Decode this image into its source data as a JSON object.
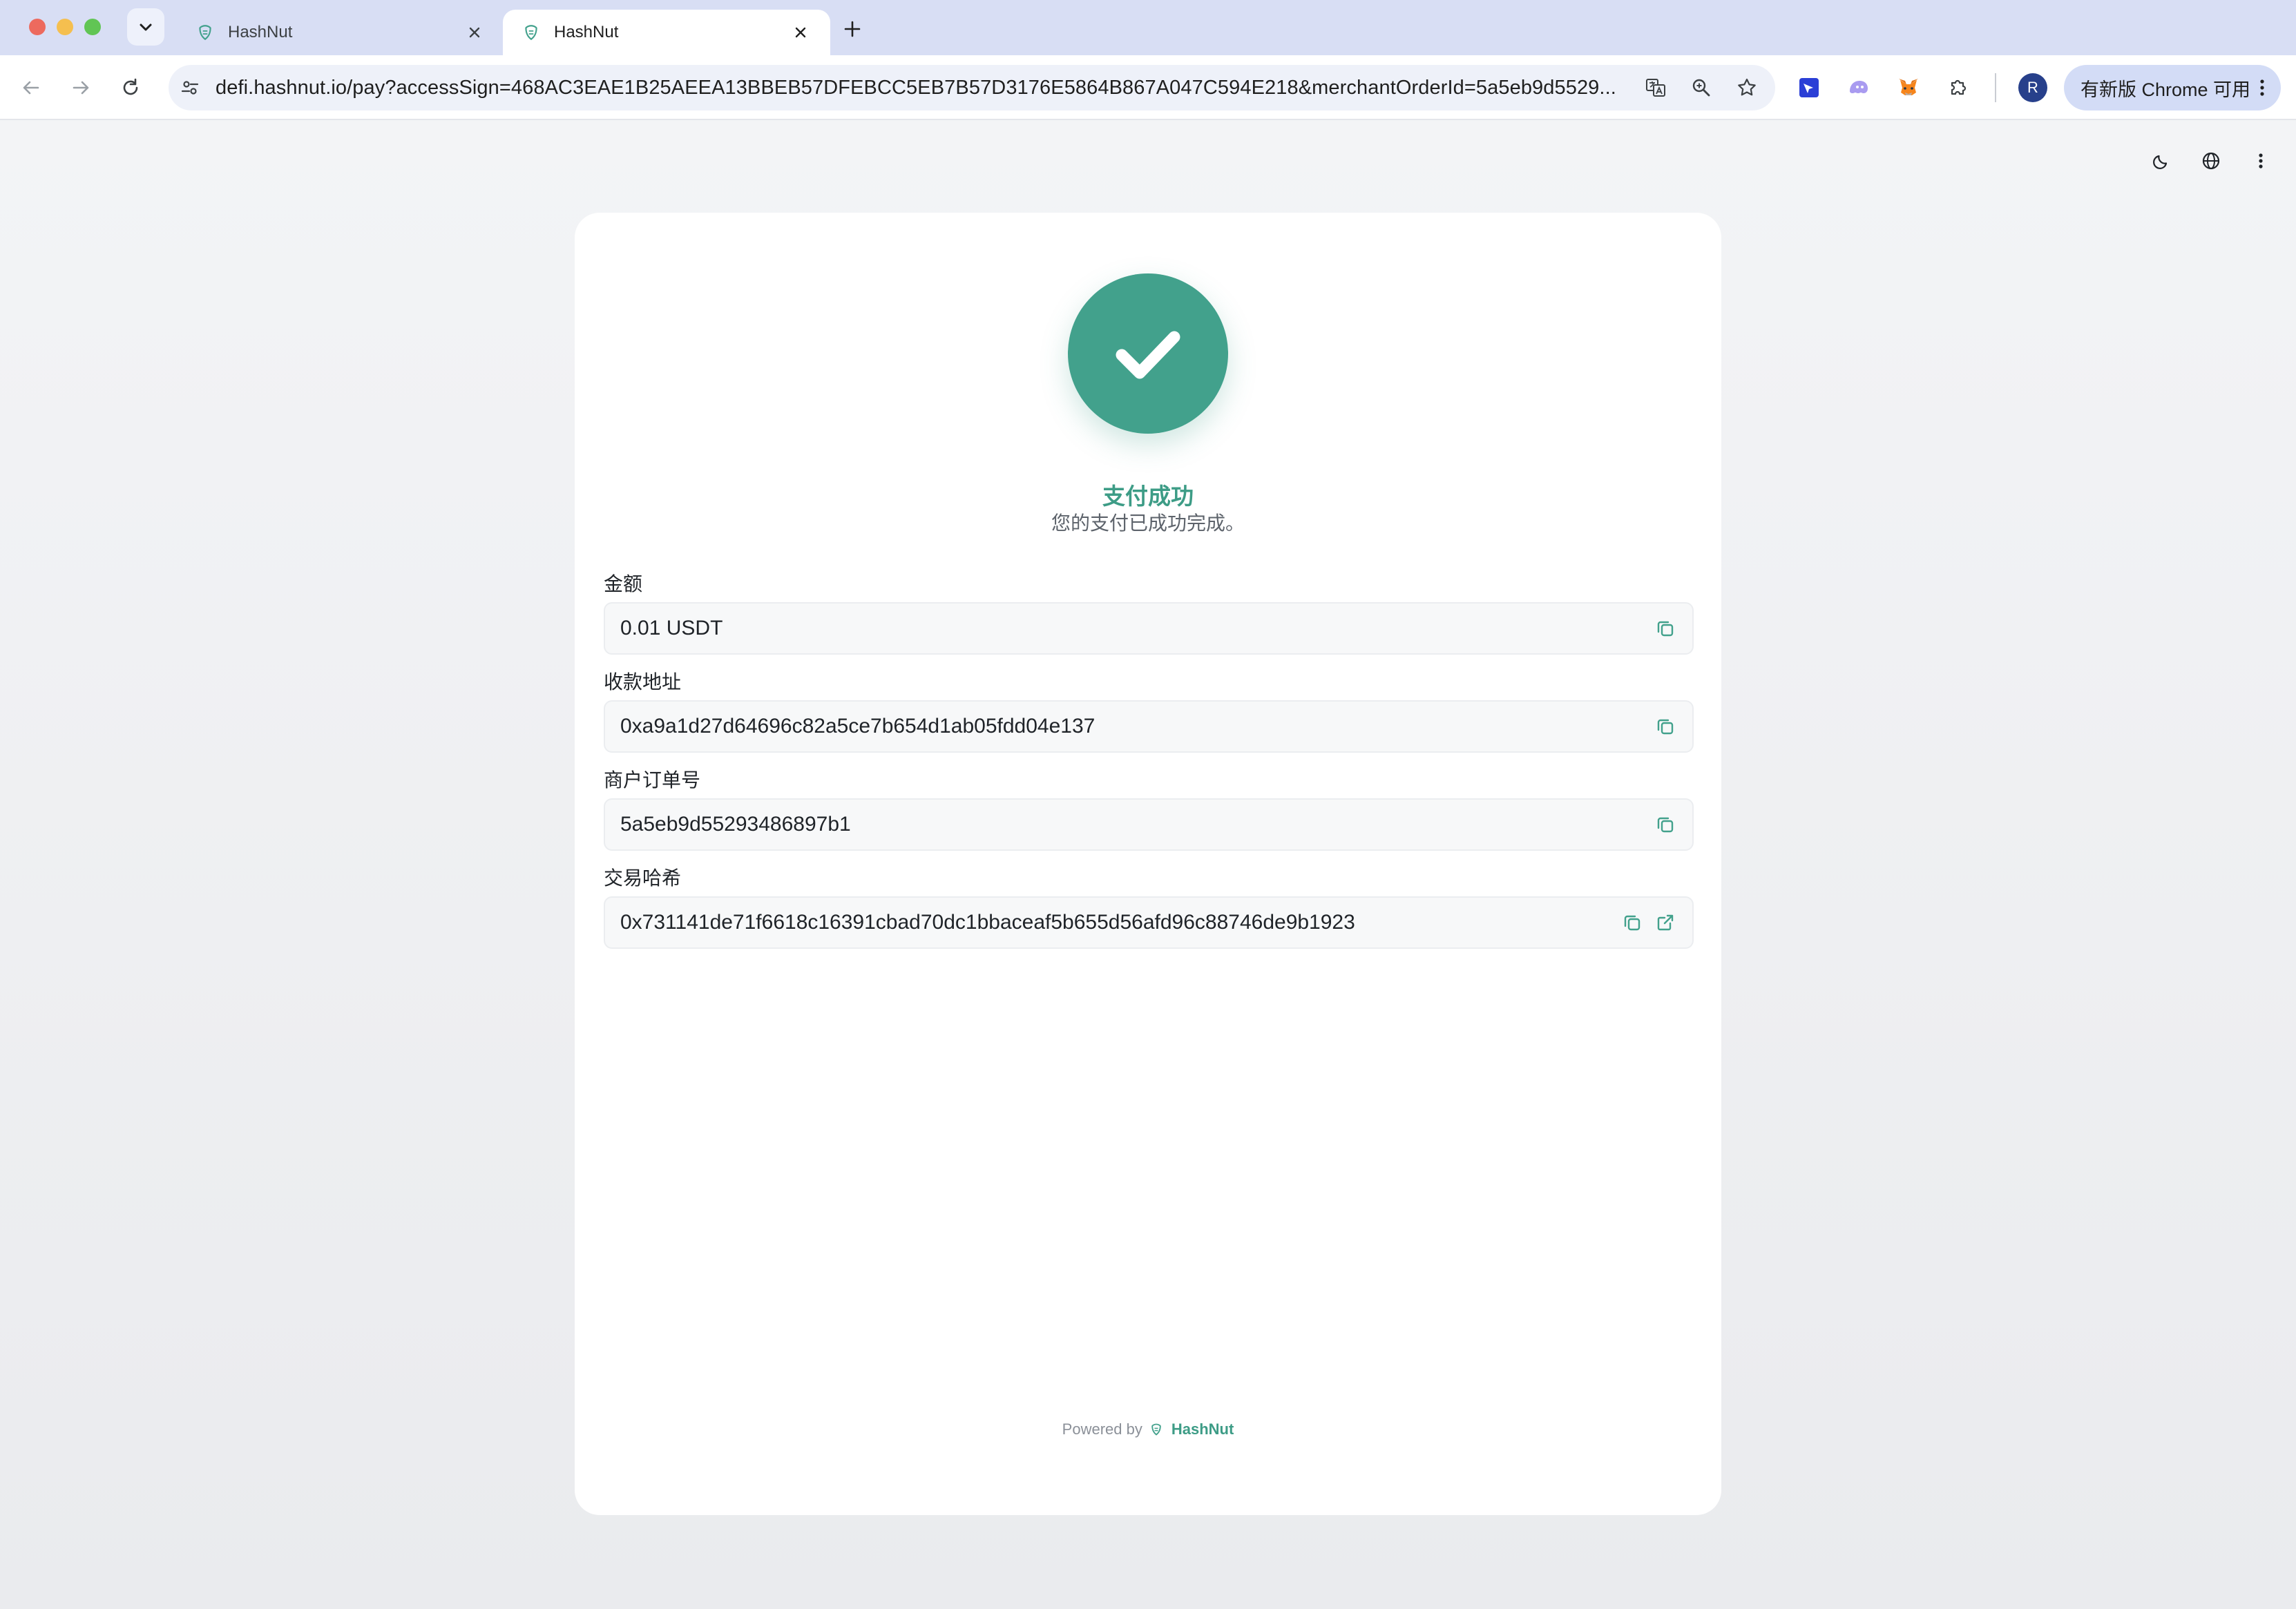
{
  "browser": {
    "tabs": [
      {
        "title": "HashNut",
        "active": false
      },
      {
        "title": "HashNut",
        "active": true
      }
    ],
    "url": "defi.hashnut.io/pay?accessSign=468AC3EAE1B25AEEA13BBEB57DFEBCC5EB7B57D3176E5864B867A047C594E218&merchantOrderId=5a5eb9d5529...",
    "avatar_letter": "R",
    "update_label": "有新版 Chrome 可用"
  },
  "status": {
    "title": "支付成功",
    "description": "您的支付已成功完成。",
    "color": "#42a18c"
  },
  "fields": [
    {
      "label": "金额",
      "value": "0.01 USDT"
    },
    {
      "label": "收款地址",
      "value": "0xa9a1d27d64696c82a5ce7b654d1ab05fdd04e137"
    },
    {
      "label": "商户订单号",
      "value": "5a5eb9d55293486897b1"
    },
    {
      "label": "交易哈希",
      "value": "0x731141de71f6618c16391cbad70dc1bbaceaf5b655d56afd96c88746de9b1923"
    }
  ],
  "footer": {
    "powered_by": "Powered by",
    "brand": "HashNut"
  },
  "icons": {
    "copy": "copy-icon",
    "external": "external-link-icon",
    "theme": "moon-icon",
    "language": "globe-icon",
    "more": "more-vertical-icon"
  }
}
